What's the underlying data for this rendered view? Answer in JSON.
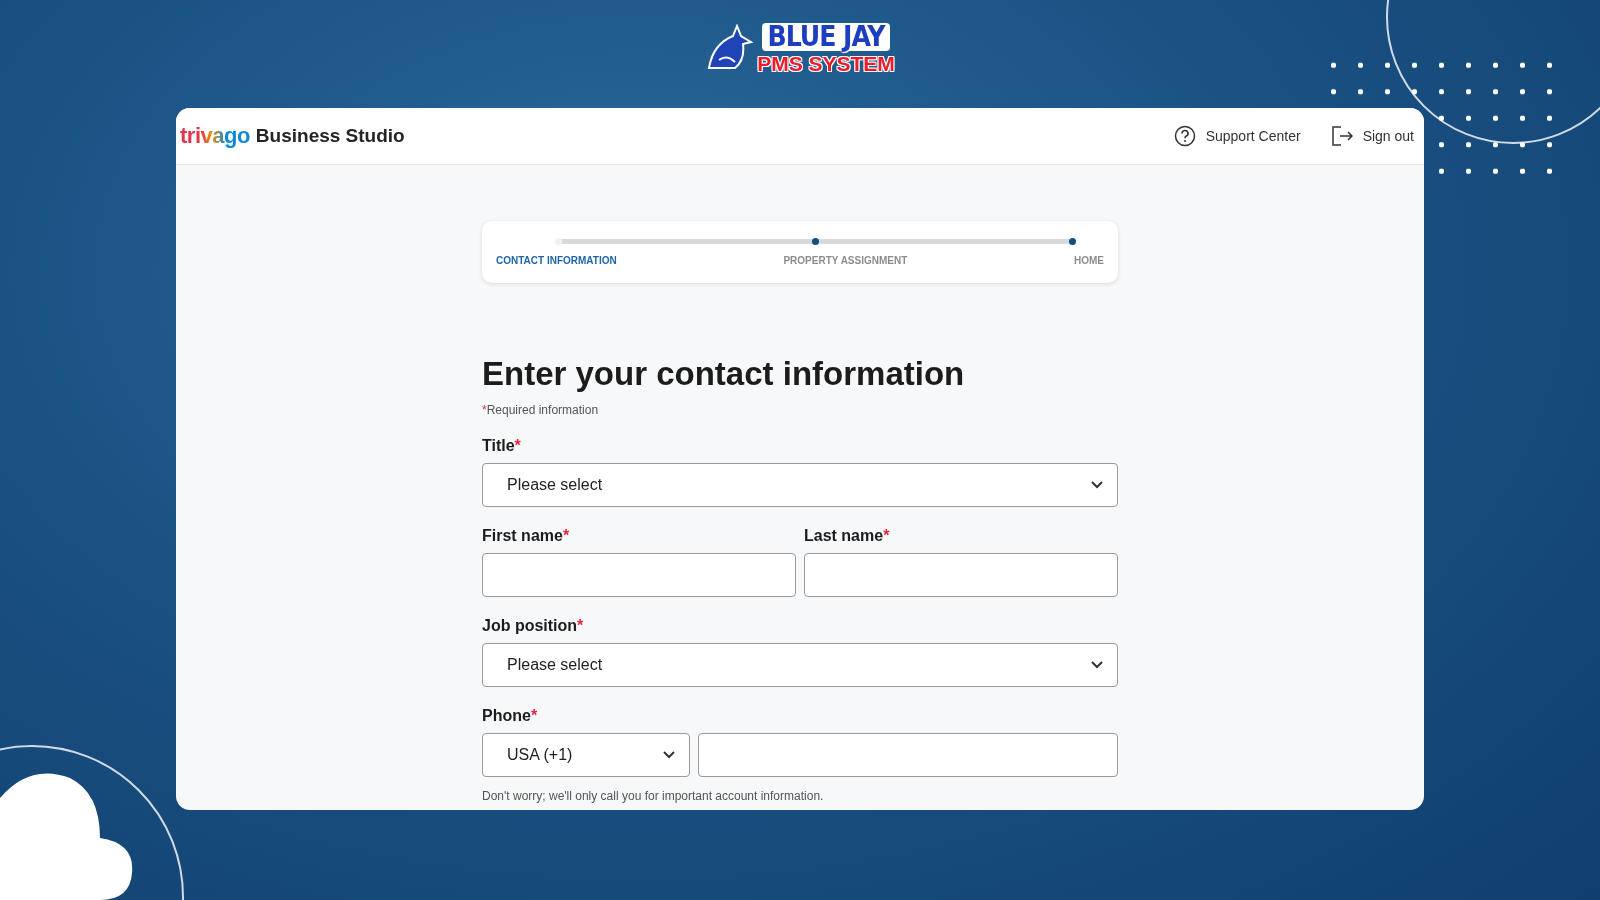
{
  "banner": {
    "logo_top": "BLUE JAY",
    "logo_bottom": "PMS SYSTEM"
  },
  "header": {
    "brand_mark": "trivago",
    "brand_name": "Business Studio",
    "links": [
      {
        "kind": "help",
        "label": "Support Center"
      },
      {
        "kind": "signout",
        "label": "Sign out"
      }
    ]
  },
  "stepper": [
    {
      "label": "CONTACT INFORMATION",
      "selected": true
    },
    {
      "label": "PROPERTY ASSIGNMENT",
      "selected": false
    },
    {
      "label": "HOME",
      "selected": false
    }
  ],
  "heading": "Enter your contact information",
  "required_note": {
    "mark": "*",
    "text": "Required information"
  },
  "fields": [
    {
      "kind": "select",
      "label": "Title",
      "mark": "*",
      "value": "Please select"
    },
    {
      "kind": "pair",
      "items": [
        {
          "label": "First name",
          "mark": "*"
        },
        {
          "label": "Last name",
          "mark": "*"
        }
      ]
    },
    {
      "kind": "select",
      "label": "Job position",
      "mark": "*",
      "value": "Please select"
    },
    {
      "kind": "phone",
      "label": "Phone",
      "mark": "*",
      "value": "USA (+1)",
      "hint": "Don't worry; we'll only call you for important account information."
    }
  ]
}
